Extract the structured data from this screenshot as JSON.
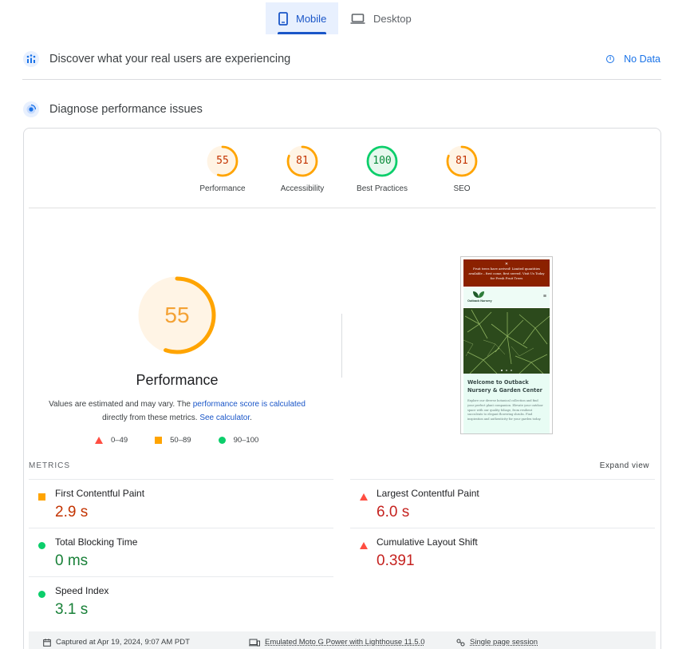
{
  "tabs": {
    "mobile": "Mobile",
    "desktop": "Desktop"
  },
  "sections": {
    "discover": {
      "title": "Discover what your real users are experiencing",
      "status": "No Data"
    },
    "diagnose": {
      "title": "Diagnose performance issues"
    }
  },
  "scores": [
    {
      "label": "Performance",
      "value": "55",
      "fraction": 0.55,
      "status": "average"
    },
    {
      "label": "Accessibility",
      "value": "81",
      "fraction": 0.81,
      "status": "average"
    },
    {
      "label": "Best Practices",
      "value": "100",
      "fraction": 1.0,
      "status": "pass"
    },
    {
      "label": "SEO",
      "value": "81",
      "fraction": 0.81,
      "status": "average"
    }
  ],
  "performance": {
    "score": "55",
    "fraction": 0.55,
    "title": "Performance",
    "desc_prefix": "Values are estimated and may vary. The ",
    "desc_link1": "performance score is calculated",
    "desc_middle": "directly from these metrics. ",
    "desc_link2": "See calculator",
    "desc_end": "."
  },
  "legend": [
    {
      "shape": "triangle",
      "range": "0–49"
    },
    {
      "shape": "square",
      "range": "50–89"
    },
    {
      "shape": "circle",
      "range": "90–100"
    }
  ],
  "screenshot": {
    "banner": "Fruit trees have arrived! Limited quantities available – first come, first served. Visit Us Today for Fresh Fruit Trees",
    "logo": "Outback Nursery",
    "welcome_title": "Welcome to Outback Nursery & Garden Center",
    "welcome_desc": "Explore our diverse botanical collection and find your perfect plant companion. Elevate your outdoor space with our quality foliage, from resilient succulents to elegant flowering shrubs. Find inspiration and authenticity for your garden today."
  },
  "metrics_label": "METRICS",
  "expand_label": "Expand view",
  "metrics": [
    {
      "name": "First Contentful Paint",
      "value": "2.9 s",
      "status": "average"
    },
    {
      "name": "Largest Contentful Paint",
      "value": "6.0 s",
      "status": "fail"
    },
    {
      "name": "Total Blocking Time",
      "value": "0 ms",
      "status": "pass"
    },
    {
      "name": "Cumulative Layout Shift",
      "value": "0.391",
      "status": "fail"
    },
    {
      "name": "Speed Index",
      "value": "3.1 s",
      "status": "pass"
    }
  ],
  "footer": {
    "captured": "Captured at Apr 19, 2024, 9:07 AM PDT",
    "device": "Emulated Moto G Power with Lighthouse 11.5.0",
    "session": "Single page session"
  },
  "colors": {
    "pass": "#0cce6b",
    "average": "#ffa400",
    "fail": "#ff4e42",
    "accent": "#1a73e8"
  }
}
